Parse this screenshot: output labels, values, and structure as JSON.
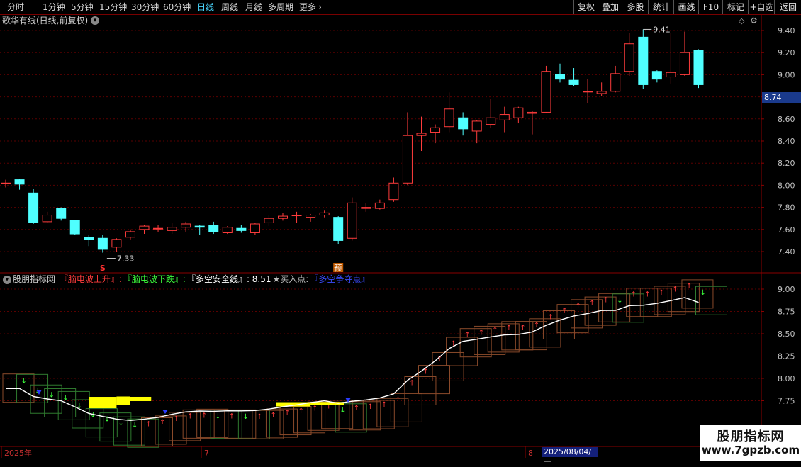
{
  "toolbar": {
    "periods": [
      {
        "label": "分时",
        "active": false
      },
      {
        "label": "1分钟",
        "active": false
      },
      {
        "label": "5分钟",
        "active": false
      },
      {
        "label": "15分钟",
        "active": false
      },
      {
        "label": "30分钟",
        "active": false
      },
      {
        "label": "60分钟",
        "active": false
      },
      {
        "label": "日线",
        "active": true
      },
      {
        "label": "周线",
        "active": false
      },
      {
        "label": "月线",
        "active": false
      },
      {
        "label": "多周期",
        "active": false
      },
      {
        "label": "更多",
        "active": false
      }
    ],
    "more_chevron": "›",
    "right_buttons": [
      "复权",
      "叠加",
      "多股",
      "统计",
      "画线",
      "F10",
      "标记",
      "+自选",
      "返回"
    ]
  },
  "price_panel": {
    "title": "歌华有线(日线,前复权)",
    "current_price": "8.74",
    "high_label": "9.41",
    "low_label": "7.33",
    "axis_ticks": [
      "9.40",
      "9.20",
      "9.00",
      "8.80",
      "8.74",
      "8.60",
      "8.40",
      "8.20",
      "8.00",
      "7.80",
      "7.60",
      "7.40"
    ],
    "marker_s": "S",
    "marker_yu": "预"
  },
  "indicator_panel": {
    "name": "股朋指标网",
    "legend": [
      {
        "text": "『脑电波上升』:",
        "color": "#ff3c3c"
      },
      {
        "text": "『脑电波下跌』:",
        "color": "#3cff3c"
      },
      {
        "text": "『多空安全线』: 8.51",
        "color": "#ffffff"
      },
      {
        "text": "★买入点:",
        "color": "#bbbbbb"
      },
      {
        "text": "『多空争夺点』",
        "color": "#3a4cff"
      }
    ],
    "axis_ticks": [
      "9.00",
      "8.75",
      "8.50",
      "8.25",
      "8.00",
      "7.75"
    ]
  },
  "date_axis": {
    "labels": [
      "2025年",
      "7",
      "8"
    ],
    "highlight": "2025/08/04/一"
  },
  "watermark": {
    "title": "股朋指标网",
    "url": "www.7gpzb.com"
  },
  "colors": {
    "up": "#ff3c3c",
    "down": "#4fffff",
    "grid": "#5a0000",
    "axis_text": "#c0c0c0"
  },
  "chart_data": {
    "type": "candlestick",
    "ylim": [
      7.3,
      9.5
    ],
    "candles": [
      {
        "o": 8.02,
        "h": 8.05,
        "l": 7.98,
        "c": 8.02
      },
      {
        "o": 8.05,
        "h": 8.06,
        "l": 7.96,
        "c": 8.01
      },
      {
        "o": 7.93,
        "h": 7.97,
        "l": 7.65,
        "c": 7.66
      },
      {
        "o": 7.67,
        "h": 7.76,
        "l": 7.66,
        "c": 7.73
      },
      {
        "o": 7.79,
        "h": 7.8,
        "l": 7.68,
        "c": 7.7
      },
      {
        "o": 7.68,
        "h": 7.68,
        "l": 7.55,
        "c": 7.56
      },
      {
        "o": 7.53,
        "h": 7.55,
        "l": 7.45,
        "c": 7.51
      },
      {
        "o": 7.52,
        "h": 7.55,
        "l": 7.39,
        "c": 7.42
      },
      {
        "o": 7.44,
        "h": 7.52,
        "l": 7.4,
        "c": 7.51
      },
      {
        "o": 7.53,
        "h": 7.6,
        "l": 7.51,
        "c": 7.58
      },
      {
        "o": 7.6,
        "h": 7.64,
        "l": 7.56,
        "c": 7.63
      },
      {
        "o": 7.61,
        "h": 7.64,
        "l": 7.58,
        "c": 7.61
      },
      {
        "o": 7.59,
        "h": 7.66,
        "l": 7.56,
        "c": 7.62
      },
      {
        "o": 7.62,
        "h": 7.67,
        "l": 7.58,
        "c": 7.65
      },
      {
        "o": 7.63,
        "h": 7.64,
        "l": 7.55,
        "c": 7.62
      },
      {
        "o": 7.64,
        "h": 7.67,
        "l": 7.56,
        "c": 7.58
      },
      {
        "o": 7.57,
        "h": 7.63,
        "l": 7.56,
        "c": 7.62
      },
      {
        "o": 7.61,
        "h": 7.64,
        "l": 7.57,
        "c": 7.59
      },
      {
        "o": 7.57,
        "h": 7.66,
        "l": 7.55,
        "c": 7.65
      },
      {
        "o": 7.66,
        "h": 7.73,
        "l": 7.63,
        "c": 7.7
      },
      {
        "o": 7.7,
        "h": 7.75,
        "l": 7.68,
        "c": 7.72
      },
      {
        "o": 7.73,
        "h": 7.76,
        "l": 7.66,
        "c": 7.73
      },
      {
        "o": 7.71,
        "h": 7.74,
        "l": 7.67,
        "c": 7.73
      },
      {
        "o": 7.73,
        "h": 7.77,
        "l": 7.71,
        "c": 7.75
      },
      {
        "o": 7.71,
        "h": 7.72,
        "l": 7.47,
        "c": 7.5
      },
      {
        "o": 7.52,
        "h": 7.89,
        "l": 7.5,
        "c": 7.84
      },
      {
        "o": 7.79,
        "h": 7.84,
        "l": 7.76,
        "c": 7.8
      },
      {
        "o": 7.79,
        "h": 7.87,
        "l": 7.78,
        "c": 7.84
      },
      {
        "o": 7.87,
        "h": 8.07,
        "l": 7.85,
        "c": 8.02
      },
      {
        "o": 8.02,
        "h": 8.66,
        "l": 8.0,
        "c": 8.45
      },
      {
        "o": 8.45,
        "h": 8.62,
        "l": 8.31,
        "c": 8.47
      },
      {
        "o": 8.48,
        "h": 8.55,
        "l": 8.38,
        "c": 8.52
      },
      {
        "o": 8.53,
        "h": 8.84,
        "l": 8.48,
        "c": 8.69
      },
      {
        "o": 8.61,
        "h": 8.66,
        "l": 8.45,
        "c": 8.51
      },
      {
        "o": 8.49,
        "h": 8.59,
        "l": 8.38,
        "c": 8.58
      },
      {
        "o": 8.55,
        "h": 8.78,
        "l": 8.52,
        "c": 8.61
      },
      {
        "o": 8.59,
        "h": 8.71,
        "l": 8.48,
        "c": 8.64
      },
      {
        "o": 8.61,
        "h": 8.71,
        "l": 8.56,
        "c": 8.7
      },
      {
        "o": 8.65,
        "h": 8.67,
        "l": 8.46,
        "c": 8.66
      },
      {
        "o": 8.66,
        "h": 9.08,
        "l": 8.65,
        "c": 9.03
      },
      {
        "o": 9.0,
        "h": 9.1,
        "l": 8.93,
        "c": 8.96
      },
      {
        "o": 8.95,
        "h": 9.06,
        "l": 8.9,
        "c": 8.91
      },
      {
        "o": 8.85,
        "h": 8.96,
        "l": 8.74,
        "c": 8.85
      },
      {
        "o": 8.83,
        "h": 8.93,
        "l": 8.81,
        "c": 8.85
      },
      {
        "o": 8.85,
        "h": 9.08,
        "l": 8.84,
        "c": 9.01
      },
      {
        "o": 9.03,
        "h": 9.38,
        "l": 8.99,
        "c": 9.28
      },
      {
        "o": 9.34,
        "h": 9.41,
        "l": 8.87,
        "c": 8.91
      },
      {
        "o": 9.03,
        "h": 9.04,
        "l": 8.93,
        "c": 8.96
      },
      {
        "o": 8.98,
        "h": 9.38,
        "l": 8.92,
        "c": 9.02
      },
      {
        "o": 9.0,
        "h": 9.39,
        "l": 8.99,
        "c": 9.2
      },
      {
        "o": 9.22,
        "h": 9.23,
        "l": 8.88,
        "c": 8.91
      }
    ]
  }
}
